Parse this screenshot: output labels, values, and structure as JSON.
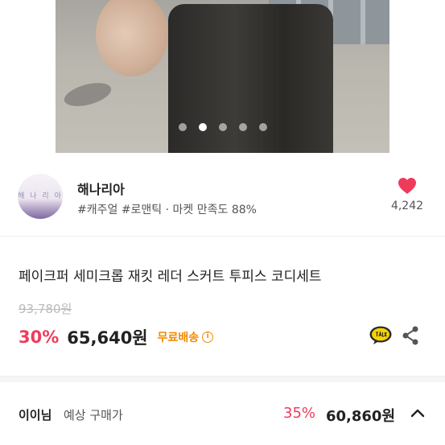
{
  "carousel": {
    "total": 5,
    "active_index": 1
  },
  "shop": {
    "avatar_text": "해 나 리 아",
    "name": "해나리아",
    "meta": "#캐주얼 #로맨틱 · 마켓 만족도 88%",
    "like_count": "4,242"
  },
  "product": {
    "title": "페이크퍼 세미크롭 재킷 레더 스커트 투피스 코디세트",
    "original_price": "93,780원",
    "discount": "30%",
    "price": "65,640원",
    "shipping": "무료배송",
    "info_icon": "i"
  },
  "member": {
    "name": "이이님",
    "label": "예상 구매가",
    "discount": "35%",
    "price": "60,860원"
  },
  "icons": {
    "heart": "heart-icon",
    "talk": "kakaotalk-icon",
    "share": "share-icon",
    "chevron": "chevron-up-icon",
    "info": "info-icon"
  },
  "colors": {
    "accent_red": "#ef3b5b",
    "shipping_orange": "#f28b00",
    "talk_yellow": "#f7d300"
  }
}
